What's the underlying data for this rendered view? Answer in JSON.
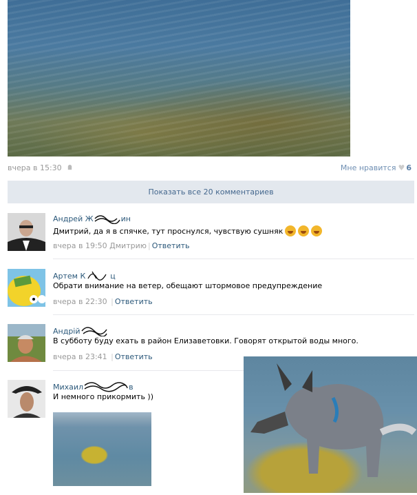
{
  "post": {
    "time": "вчера в 15:30",
    "like_label": "Мне нравится",
    "like_count": "6",
    "show_all": "Показать все 20 комментариев"
  },
  "comments": [
    {
      "name": "Андрей Ж",
      "name_tail": "ин",
      "text": "Дмитрий, да я в спячке, тут проснулся, чувствую сушняк",
      "time": "вчера в 19:50",
      "to": "Дмитрию",
      "reply": "Ответить"
    },
    {
      "name": "Артем К",
      "name_tail": "ц",
      "text": "Обрати внимание на ветер, обещают штормовое предупреждение",
      "time": "вчера в 22:30",
      "to": "",
      "reply": "Ответить"
    },
    {
      "name": "Андрій",
      "name_tail": "",
      "text": "В субботу буду ехать в район Елизаветовки. Говорят открытой воды много.",
      "time": "вчера в 23:41",
      "to": "",
      "reply": "Ответить"
    },
    {
      "name": "Михаил",
      "name_tail": "в",
      "text": "И немного прикормить ))",
      "time": "",
      "to": "",
      "reply": ""
    }
  ],
  "icons": {
    "like": "heart-icon",
    "platform": "android-icon"
  }
}
